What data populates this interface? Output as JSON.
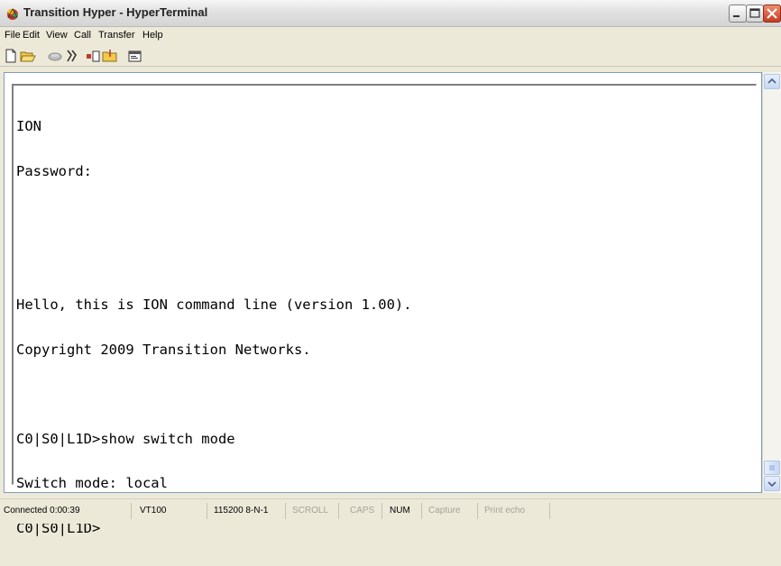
{
  "window": {
    "title": "Transition Hyper - HyperTerminal",
    "icon": "hyperterminal-app-icon",
    "controls": [
      "minimize-icon",
      "maximize-icon",
      "close-icon"
    ]
  },
  "menu": {
    "items": [
      "File",
      "Edit",
      "View",
      "Call",
      "Transfer",
      "Help"
    ]
  },
  "toolbar": {
    "icons": [
      "new-connection-icon",
      "open-icon",
      "disconnect-phone-icon",
      "dial-icon",
      "send-icon",
      "receive-icon",
      "properties-icon"
    ]
  },
  "terminal": {
    "lines": [
      "ION",
      "Password:",
      "",
      "",
      "Hello, this is ION command line (version 1.00).",
      "Copyright 2009 Transition Networks.",
      "",
      "C0|S0|L1D>show switch mode",
      "Switch mode: local",
      "C0|S0|L1D>"
    ]
  },
  "status": {
    "connected": "Connected 0:00:39",
    "emulation": "VT100",
    "settings": "115200 8-N-1",
    "scroll": "SCROLL",
    "caps": "CAPS",
    "num": "NUM",
    "capture": "Capture",
    "print_echo": "Print echo"
  }
}
